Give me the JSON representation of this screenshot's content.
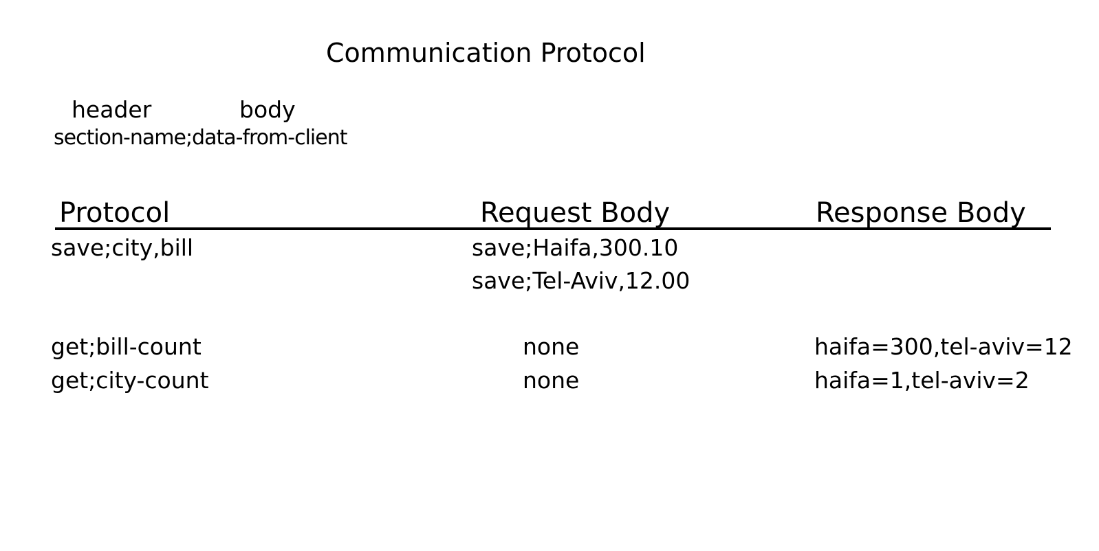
{
  "title": "Communication Protocol",
  "format": {
    "header_label": "header",
    "body_label": "body",
    "example": "section-name;data-from-client"
  },
  "table": {
    "columns": [
      "Protocol",
      "Request Body",
      "Response Body"
    ],
    "rows": [
      {
        "protocol": "save;city,bill",
        "request": [
          "save;Haifa,300.10",
          "save;Tel-Aviv,12.00"
        ],
        "response": ""
      },
      {
        "protocol": "get;bill-count",
        "request": [
          "none"
        ],
        "response": "haifa=300,tel-aviv=12"
      },
      {
        "protocol": "get;city-count",
        "request": [
          "none"
        ],
        "response": "haifa=1,tel-aviv=2"
      }
    ]
  }
}
